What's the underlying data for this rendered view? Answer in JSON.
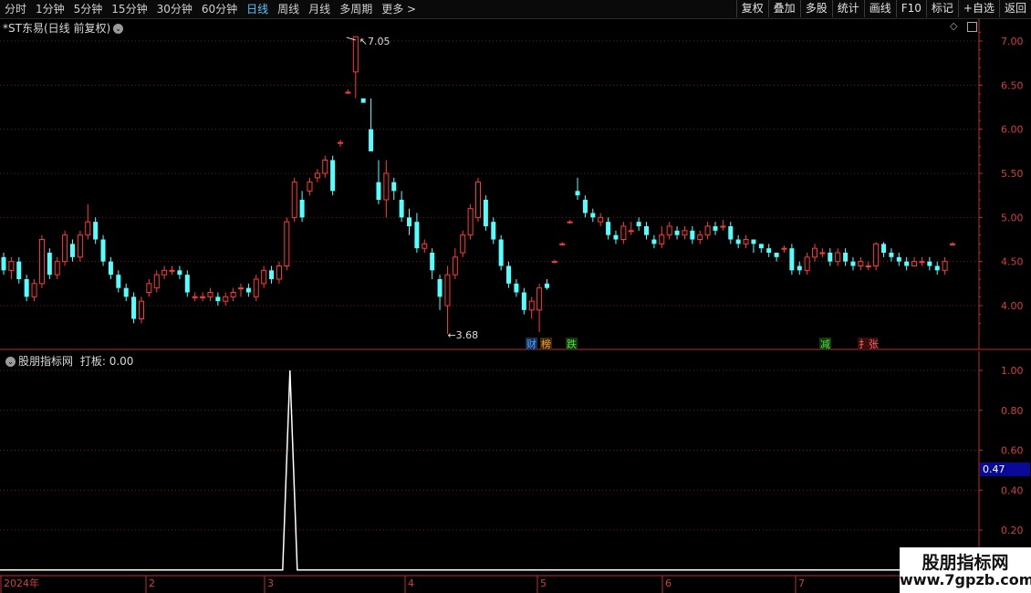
{
  "toolbar": {
    "periods": [
      "分时",
      "1分钟",
      "5分钟",
      "15分钟",
      "30分钟",
      "60分钟",
      "日线",
      "周线",
      "月线",
      "多周期",
      "更多"
    ],
    "active_period": "日线",
    "more_arrow": ">",
    "buttons": [
      "复权",
      "叠加",
      "多股",
      "统计",
      "画线",
      "F10",
      "标记",
      "+自选",
      "返回"
    ]
  },
  "main_panel": {
    "title": "*ST东易(日线 前复权)",
    "high_label": "7.05",
    "low_label": "3.68",
    "event_tags": [
      {
        "text": "财",
        "color": "#5aa0ff",
        "bg": "#12325a"
      },
      {
        "text": "榜",
        "color": "#ff9a3a",
        "bg": "#3a2a00"
      },
      {
        "text": "跌",
        "color": "#5adc3a",
        "bg": "#0e3a0e"
      },
      {
        "text": "减",
        "color": "#5adc3a",
        "bg": "#0e3a0e"
      },
      {
        "text": "扌张",
        "color": "#ff6060",
        "bg": "#3a0e0e"
      }
    ]
  },
  "price_axis": [
    "7.00",
    "6.50",
    "6.00",
    "5.50",
    "5.00",
    "4.50",
    "4.00"
  ],
  "indicator_panel": {
    "title": "股朋指标网",
    "indicator_name": "打板:",
    "indicator_value": "0.00",
    "axis": [
      "1.00",
      "0.80",
      "0.60",
      "0.40",
      "0.20"
    ],
    "current_box": "0.47"
  },
  "date_axis": [
    "2024年",
    "2",
    "3",
    "4",
    "5",
    "6",
    "7"
  ],
  "watermark": {
    "line1": "股朋指标网",
    "line2": "www.7gpzb.com"
  },
  "colors": {
    "up": "#ff3a3a",
    "down": "#54ffff",
    "grid": "#7a1a1a",
    "axis": "#b83030"
  },
  "chart_data": {
    "type": "candlestick",
    "y_axis_range": [
      3.55,
      7.2
    ],
    "candles": [
      [
        4.55,
        4.4,
        4.6,
        4.35
      ],
      [
        4.4,
        4.5,
        4.55,
        4.3
      ],
      [
        4.5,
        4.3,
        4.55,
        4.25
      ],
      [
        4.3,
        4.1,
        4.35,
        4.05
      ],
      [
        4.1,
        4.25,
        4.3,
        4.05
      ],
      [
        4.25,
        4.75,
        4.8,
        4.2
      ],
      [
        4.6,
        4.35,
        4.65,
        4.3
      ],
      [
        4.35,
        4.5,
        4.55,
        4.3
      ],
      [
        4.5,
        4.8,
        4.85,
        4.45
      ],
      [
        4.7,
        4.55,
        4.75,
        4.5
      ],
      [
        4.55,
        4.8,
        4.85,
        4.5
      ],
      [
        4.8,
        4.95,
        5.15,
        4.75
      ],
      [
        4.95,
        4.75,
        5.0,
        4.7
      ],
      [
        4.75,
        4.5,
        4.8,
        4.45
      ],
      [
        4.5,
        4.35,
        4.55,
        4.3
      ],
      [
        4.35,
        4.2,
        4.4,
        4.15
      ],
      [
        4.2,
        4.1,
        4.25,
        4.05
      ],
      [
        4.1,
        3.85,
        4.15,
        3.8
      ],
      [
        3.85,
        4.05,
        4.1,
        3.8
      ],
      [
        4.15,
        4.25,
        4.3,
        4.1
      ],
      [
        4.2,
        4.35,
        4.4,
        4.15
      ],
      [
        4.35,
        4.4,
        4.45,
        4.3
      ],
      [
        4.4,
        4.4,
        4.45,
        4.35
      ],
      [
        4.4,
        4.35,
        4.45,
        4.3
      ],
      [
        4.35,
        4.15,
        4.4,
        4.1
      ],
      [
        4.1,
        4.1,
        4.15,
        4.05
      ],
      [
        4.1,
        4.1,
        4.15,
        4.05
      ],
      [
        4.1,
        4.15,
        4.2,
        4.05
      ],
      [
        4.1,
        4.05,
        4.15,
        4.0
      ],
      [
        4.05,
        4.1,
        4.15,
        4.0
      ],
      [
        4.1,
        4.15,
        4.2,
        4.05
      ],
      [
        4.2,
        4.2,
        4.25,
        4.1
      ],
      [
        4.2,
        4.15,
        4.25,
        4.1
      ],
      [
        4.1,
        4.3,
        4.35,
        4.05
      ],
      [
        4.25,
        4.4,
        4.45,
        4.2
      ],
      [
        4.4,
        4.3,
        4.45,
        4.25
      ],
      [
        4.3,
        4.45,
        4.5,
        4.25
      ],
      [
        4.45,
        4.95,
        5.0,
        4.4
      ],
      [
        5.0,
        5.4,
        5.45,
        4.95
      ],
      [
        5.2,
        5.0,
        5.3,
        4.95
      ],
      [
        5.3,
        5.4,
        5.45,
        5.25
      ],
      [
        5.45,
        5.5,
        5.55,
        5.4
      ],
      [
        5.5,
        5.65,
        5.7,
        5.45
      ],
      [
        5.65,
        5.3,
        5.7,
        5.25
      ],
      [
        5.85,
        5.85,
        5.88,
        5.8
      ],
      [
        6.42,
        6.42,
        6.45,
        6.4
      ],
      [
        6.65,
        7.05,
        7.05,
        6.35
      ],
      [
        6.35,
        6.3,
        6.35,
        6.3
      ],
      [
        6.0,
        5.75,
        6.35,
        5.75
      ],
      [
        5.4,
        5.2,
        5.65,
        5.15
      ],
      [
        5.2,
        5.5,
        5.65,
        5.0
      ],
      [
        5.4,
        5.3,
        5.45,
        5.2
      ],
      [
        5.2,
        5.0,
        5.3,
        4.95
      ],
      [
        5.0,
        4.9,
        5.1,
        4.8
      ],
      [
        4.95,
        4.65,
        5.05,
        4.6
      ],
      [
        4.65,
        4.7,
        4.75,
        4.6
      ],
      [
        4.6,
        4.4,
        4.65,
        4.3
      ],
      [
        4.3,
        4.1,
        4.35,
        3.95
      ],
      [
        4.0,
        4.35,
        4.45,
        3.68
      ],
      [
        4.35,
        4.55,
        4.65,
        4.3
      ],
      [
        4.6,
        4.8,
        4.85,
        4.55
      ],
      [
        4.8,
        5.1,
        5.15,
        4.75
      ],
      [
        5.0,
        5.4,
        5.45,
        4.95
      ],
      [
        5.2,
        4.9,
        5.25,
        4.85
      ],
      [
        4.95,
        4.75,
        5.0,
        4.7
      ],
      [
        4.75,
        4.45,
        4.8,
        4.4
      ],
      [
        4.45,
        4.25,
        4.5,
        4.2
      ],
      [
        4.25,
        4.15,
        4.3,
        4.1
      ],
      [
        4.15,
        3.95,
        4.2,
        3.9
      ],
      [
        3.95,
        4.05,
        4.1,
        3.85
      ],
      [
        3.95,
        4.2,
        4.25,
        3.7
      ],
      [
        4.25,
        4.2,
        4.3,
        4.18
      ],
      [
        4.5,
        4.5,
        4.52,
        4.48
      ],
      [
        4.7,
        4.7,
        4.72,
        4.68
      ],
      [
        4.95,
        4.95,
        4.97,
        4.93
      ],
      [
        5.3,
        5.25,
        5.45,
        5.2
      ],
      [
        5.2,
        5.05,
        5.25,
        5.0
      ],
      [
        5.05,
        5.0,
        5.1,
        4.95
      ],
      [
        4.95,
        5.0,
        5.05,
        4.9
      ],
      [
        4.95,
        4.8,
        5.0,
        4.75
      ],
      [
        4.8,
        4.75,
        4.85,
        4.7
      ],
      [
        4.75,
        4.9,
        4.95,
        4.7
      ],
      [
        4.85,
        4.85,
        4.95,
        4.8
      ],
      [
        4.95,
        4.9,
        5.0,
        4.85
      ],
      [
        4.9,
        4.8,
        4.95,
        4.75
      ],
      [
        4.75,
        4.7,
        4.8,
        4.65
      ],
      [
        4.7,
        4.8,
        4.9,
        4.65
      ],
      [
        4.8,
        4.9,
        4.95,
        4.75
      ],
      [
        4.85,
        4.8,
        4.9,
        4.75
      ],
      [
        4.8,
        4.85,
        4.9,
        4.75
      ],
      [
        4.85,
        4.75,
        4.9,
        4.7
      ],
      [
        4.75,
        4.8,
        4.85,
        4.7
      ],
      [
        4.8,
        4.9,
        4.95,
        4.75
      ],
      [
        4.9,
        4.85,
        4.95,
        4.8
      ],
      [
        4.9,
        4.9,
        4.97,
        4.85
      ],
      [
        4.9,
        4.75,
        4.95,
        4.7
      ],
      [
        4.75,
        4.7,
        4.8,
        4.65
      ],
      [
        4.7,
        4.75,
        4.8,
        4.65
      ],
      [
        4.75,
        4.7,
        4.75,
        4.6
      ],
      [
        4.7,
        4.65,
        4.7,
        4.6
      ],
      [
        4.65,
        4.6,
        4.7,
        4.55
      ],
      [
        4.6,
        4.55,
        4.6,
        4.5
      ],
      [
        4.65,
        4.65,
        4.68,
        4.6
      ],
      [
        4.65,
        4.4,
        4.7,
        4.35
      ],
      [
        4.45,
        4.4,
        4.5,
        4.35
      ],
      [
        4.4,
        4.55,
        4.6,
        4.35
      ],
      [
        4.55,
        4.65,
        4.7,
        4.5
      ],
      [
        4.6,
        4.6,
        4.65,
        4.55
      ],
      [
        4.6,
        4.5,
        4.65,
        4.45
      ],
      [
        4.5,
        4.6,
        4.65,
        4.45
      ],
      [
        4.6,
        4.5,
        4.65,
        4.45
      ],
      [
        4.5,
        4.45,
        4.55,
        4.4
      ],
      [
        4.45,
        4.5,
        4.55,
        4.4
      ],
      [
        4.45,
        4.45,
        4.5,
        4.4
      ],
      [
        4.45,
        4.7,
        4.72,
        4.4
      ],
      [
        4.7,
        4.6,
        4.72,
        4.55
      ],
      [
        4.6,
        4.55,
        4.65,
        4.5
      ],
      [
        4.55,
        4.5,
        4.6,
        4.45
      ],
      [
        4.5,
        4.45,
        4.55,
        4.4
      ],
      [
        4.45,
        4.5,
        4.55,
        4.45
      ],
      [
        4.5,
        4.5,
        4.55,
        4.45
      ],
      [
        4.5,
        4.45,
        4.55,
        4.4
      ],
      [
        4.45,
        4.4,
        4.5,
        4.35
      ],
      [
        4.4,
        4.5,
        4.55,
        4.35
      ],
      [
        4.7,
        4.7,
        4.72,
        4.68
      ]
    ],
    "indicator": {
      "name": "打板",
      "values_nonzero": [
        {
          "index": 46,
          "value": 1.0
        }
      ],
      "baseline": 0.0
    }
  }
}
